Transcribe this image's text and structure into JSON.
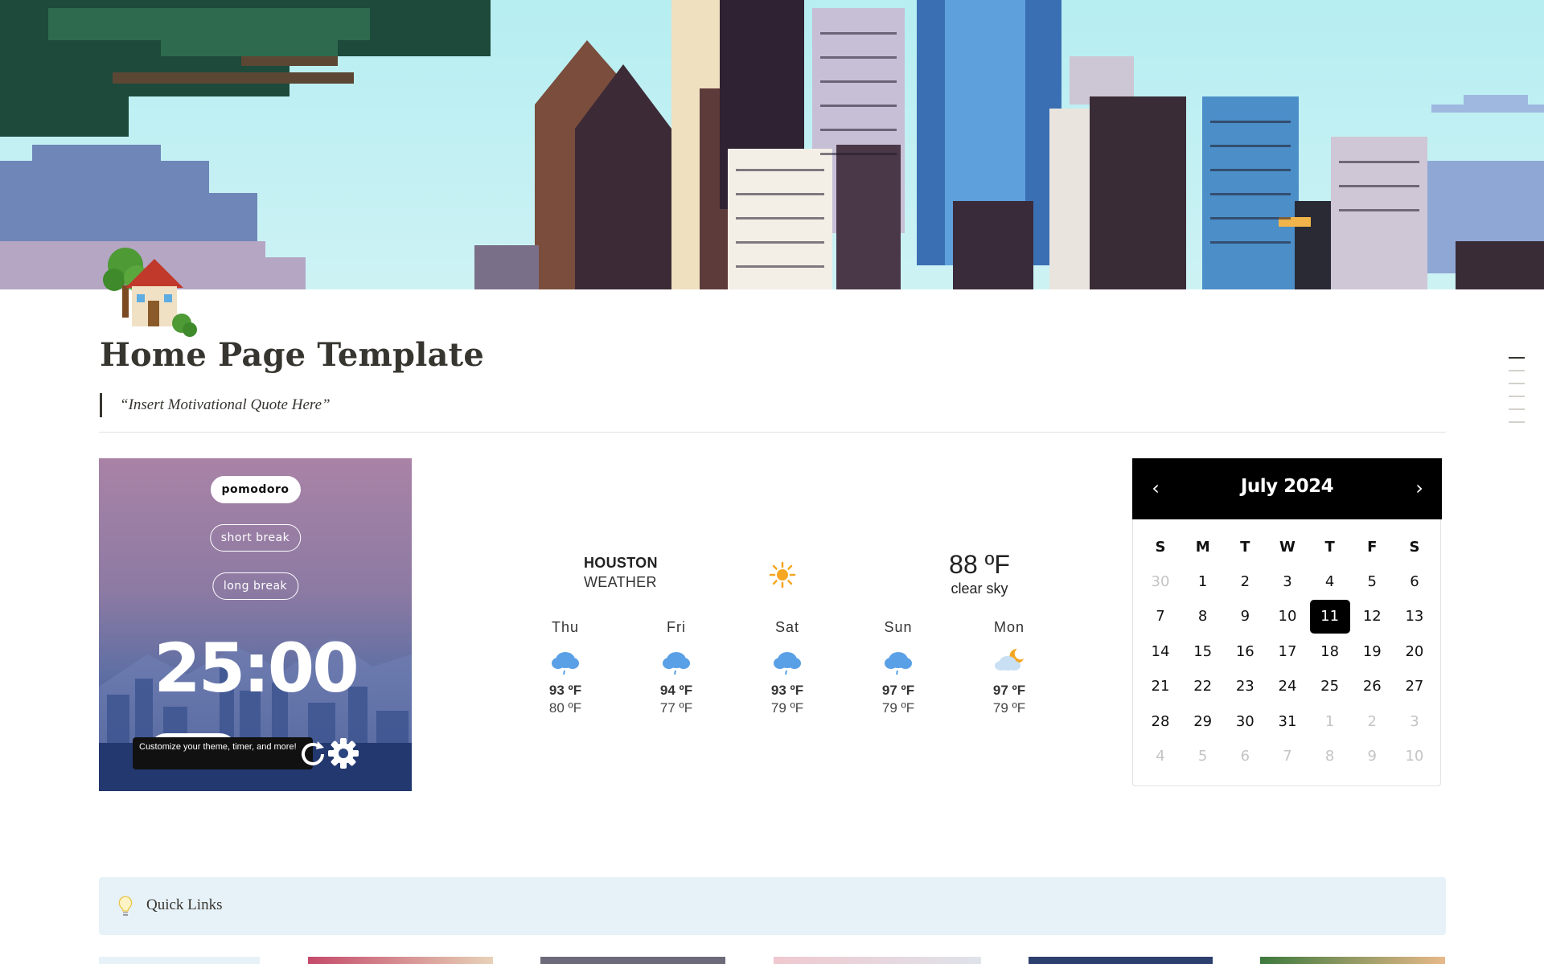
{
  "page": {
    "title": "Home Page Template",
    "quote": "“Insert Motivational Quote Here”"
  },
  "pomodoro": {
    "modes": [
      "pomodoro",
      "short break",
      "long break"
    ],
    "active_mode": "pomodoro",
    "timer": "25:00",
    "tooltip": "Customize your theme, timer, and more!"
  },
  "weather": {
    "city": "HOUSTON",
    "subtitle": "WEATHER",
    "current_temp": "88 ºF",
    "condition": "clear sky",
    "current_icon": "sun-icon",
    "forecast": [
      {
        "day": "Thu",
        "high": "93 ºF",
        "low": "80 ºF",
        "icon": "rain-cloud-icon"
      },
      {
        "day": "Fri",
        "high": "94 ºF",
        "low": "77 ºF",
        "icon": "rain-cloud-icon"
      },
      {
        "day": "Sat",
        "high": "93 ºF",
        "low": "79 ºF",
        "icon": "rain-cloud-icon"
      },
      {
        "day": "Sun",
        "high": "97 ºF",
        "low": "79 ºF",
        "icon": "rain-cloud-icon"
      },
      {
        "day": "Mon",
        "high": "97 ºF",
        "low": "79 ºF",
        "icon": "moon-cloud-icon"
      }
    ]
  },
  "calendar": {
    "month_label": "July 2024",
    "weekdays": [
      "S",
      "M",
      "T",
      "W",
      "T",
      "F",
      "S"
    ],
    "today": "11",
    "days": [
      {
        "d": "30",
        "muted": true
      },
      {
        "d": "1"
      },
      {
        "d": "2"
      },
      {
        "d": "3"
      },
      {
        "d": "4"
      },
      {
        "d": "5"
      },
      {
        "d": "6"
      },
      {
        "d": "7"
      },
      {
        "d": "8"
      },
      {
        "d": "9"
      },
      {
        "d": "10"
      },
      {
        "d": "11",
        "today": true
      },
      {
        "d": "12"
      },
      {
        "d": "13"
      },
      {
        "d": "14"
      },
      {
        "d": "15"
      },
      {
        "d": "16"
      },
      {
        "d": "17"
      },
      {
        "d": "18"
      },
      {
        "d": "19"
      },
      {
        "d": "20"
      },
      {
        "d": "21"
      },
      {
        "d": "22"
      },
      {
        "d": "23"
      },
      {
        "d": "24"
      },
      {
        "d": "25"
      },
      {
        "d": "26"
      },
      {
        "d": "27"
      },
      {
        "d": "28"
      },
      {
        "d": "29"
      },
      {
        "d": "30"
      },
      {
        "d": "31"
      },
      {
        "d": "1",
        "muted": true
      },
      {
        "d": "2",
        "muted": true
      },
      {
        "d": "3",
        "muted": true
      },
      {
        "d": "4",
        "muted": true
      },
      {
        "d": "5",
        "muted": true
      },
      {
        "d": "6",
        "muted": true
      },
      {
        "d": "7",
        "muted": true
      },
      {
        "d": "8",
        "muted": true
      },
      {
        "d": "9",
        "muted": true
      },
      {
        "d": "10",
        "muted": true
      }
    ]
  },
  "quick_links": {
    "label": "Quick Links",
    "icon": "lightbulb-icon"
  },
  "colors": {
    "text": "#37352f",
    "calendar_header": "#000000",
    "quick_links_bg": "#e7f2f8",
    "rain_icon": "#5aa0e6",
    "sun_icon": "#f5a623"
  }
}
